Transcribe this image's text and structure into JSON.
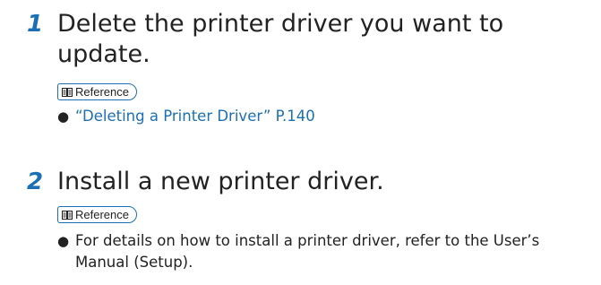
{
  "steps": [
    {
      "number": "1",
      "text": "Delete the printer driver you want to update.",
      "reference_label": "Reference",
      "bullet": "“Deleting a Printer Driver” P.140"
    },
    {
      "number": "2",
      "text": "Install a new printer driver.",
      "reference_label": "Reference",
      "bullet": "For details on how to install a printer driver, refer to the User’s Manual (Setup)."
    }
  ],
  "colors": {
    "accent": "#1a6fb5",
    "text": "#222222"
  },
  "icons": {
    "reference": "book-icon",
    "bullet": "bullet-dot-icon"
  }
}
